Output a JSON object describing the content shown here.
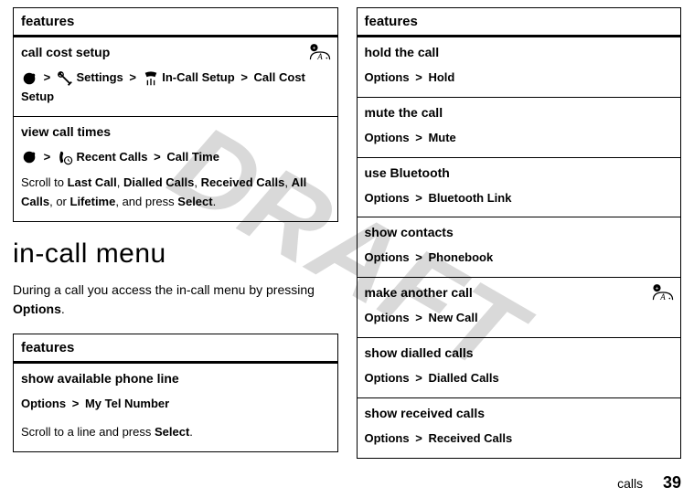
{
  "watermark": "DRAFT",
  "left_table1": {
    "header": "features",
    "rows": [
      {
        "title": "call cost setup",
        "path_parts": [
          "Settings",
          "In-Call Setup",
          "Call Cost Setup"
        ],
        "has_net_icon": true
      },
      {
        "title": "view call times",
        "path_lead": "Recent Calls",
        "path_tail": "Call Time",
        "scroll_prefix": "Scroll to",
        "scroll_items": [
          "Last Call",
          "Dialled Calls",
          "Received Calls",
          "All Calls"
        ],
        "scroll_or": "or",
        "scroll_last": "Lifetime",
        "scroll_suffix": ", and press",
        "scroll_action": "Select"
      }
    ]
  },
  "section_heading": "in-call menu",
  "section_intro_a": "During a call you access the in-call menu by pressing",
  "section_intro_b": "Options",
  "left_table2": {
    "header": "features",
    "row": {
      "title": "show available phone line",
      "path_a": "Options",
      "path_b": "My Tel Number",
      "scroll_text": "Scroll to a line and press",
      "scroll_action": "Select"
    }
  },
  "right_table": {
    "header": "features",
    "rows": [
      {
        "title": "hold the call",
        "a": "Options",
        "b": "Hold"
      },
      {
        "title": "mute the call",
        "a": "Options",
        "b": "Mute"
      },
      {
        "title": "use Bluetooth",
        "a": "Options",
        "b": "Bluetooth Link"
      },
      {
        "title": "show contacts",
        "a": "Options",
        "b": "Phonebook"
      },
      {
        "title": "make another call",
        "a": "Options",
        "b": "New Call",
        "has_net_icon": true
      },
      {
        "title": "show dialled calls",
        "a": "Options",
        "b": "Dialled Calls"
      },
      {
        "title": "show received calls",
        "a": "Options",
        "b": "Received Calls"
      }
    ]
  },
  "footer_label": "calls",
  "footer_page": "39",
  "glyphs": {
    "gt": ">"
  }
}
